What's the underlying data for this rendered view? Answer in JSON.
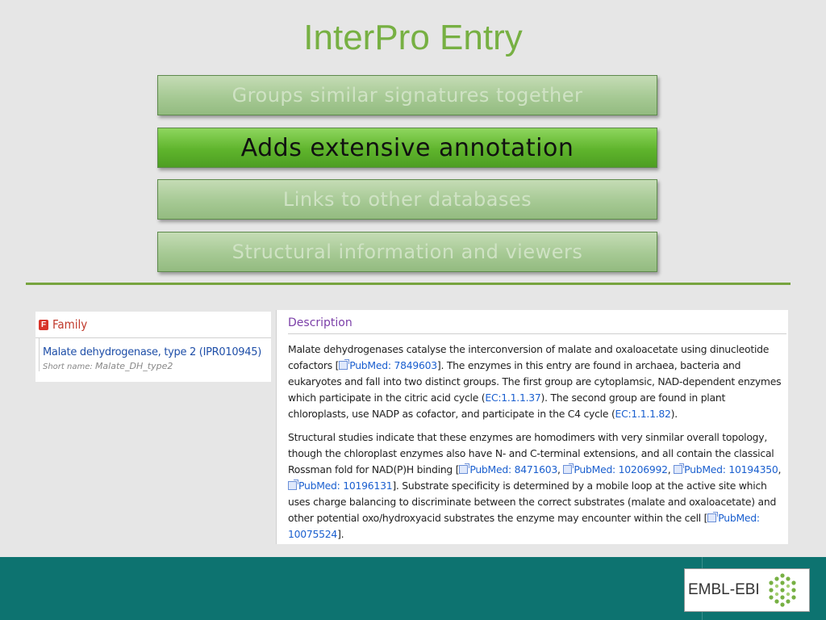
{
  "slide": {
    "title": "InterPro Entry"
  },
  "boxes": [
    {
      "label": "Groups similar signatures together",
      "state": "dim"
    },
    {
      "label": "Adds extensive annotation",
      "state": "active"
    },
    {
      "label": "Links to other databases",
      "state": "dim"
    },
    {
      "label": "Structural information and viewers",
      "state": "dim"
    }
  ],
  "family": {
    "badge": "F",
    "label": "Family",
    "name": "Malate dehydrogenase, type 2 (IPR010945)",
    "short_name_label": "Short name:",
    "short_name_value": "Malate_DH_type2"
  },
  "description": {
    "heading": "Description",
    "p1": {
      "t1": "Malate dehydrogenases catalyse the interconversion of malate and oxaloacetate using dinucleotide cofactors [",
      "link1": "PubMed: 7849603",
      "t2": "]. The enzymes in this entry are found in archaea, bacteria and eukaryotes and fall into two distinct groups. The first group are cytoplamsic, NAD-dependent enzymes which participate in the citric acid cycle (",
      "link2": "EC:1.1.1.37",
      "t3": "). The second group are found in plant chloroplasts, use NADP as cofactor, and participate in the C4 cycle (",
      "link3": "EC:1.1.1.82",
      "t4": ")."
    },
    "p2": {
      "t1": "Structural studies indicate that these enzymes are homodimers with very sinmilar overall topology, though the chloroplast enzymes also have N- and C-terminal extensions, and all contain the classical Rossman fold for NAD(P)H binding [",
      "link1": "PubMed: 8471603",
      "sep1": ", ",
      "link2": "PubMed: 10206992",
      "sep2": ", ",
      "link3": "PubMed: 10194350",
      "sep3": ", ",
      "link4": "PubMed: 10196131",
      "t2": "]. Substrate specificity is determined by a mobile loop at the active site which uses charge balancing to discriminate between the correct substrates (malate and oxaloacetate) and other potential oxo/hydroxyacid substrates the enzyme may encounter within the cell [",
      "link5": "PubMed: 10075524",
      "t3": "]."
    }
  },
  "footer": {
    "logo_text": "EMBL-EBI",
    "bg_color": "#0d7370"
  },
  "colors": {
    "accent_green": "#77b043",
    "active_box": "#5fb42c",
    "link": "#1a5fcf"
  }
}
